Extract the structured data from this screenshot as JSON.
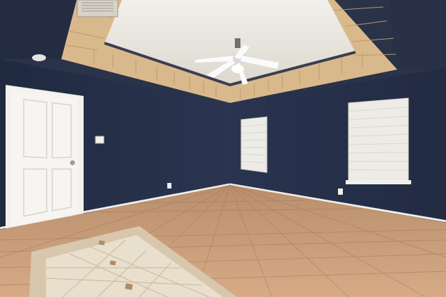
{
  "scene": {
    "subject": "empty-room",
    "colors": {
      "wall": "#27324a",
      "wall_shadow": "#1f2940",
      "ceiling": "#e9e6df",
      "tray_tile": "#d9b98c",
      "floor_tile": "#c89a72",
      "floor_inset": "#e7dccb",
      "door": "#f3f2ee",
      "trim": "#f2f1ec",
      "blinds": "#ecebe6"
    }
  }
}
